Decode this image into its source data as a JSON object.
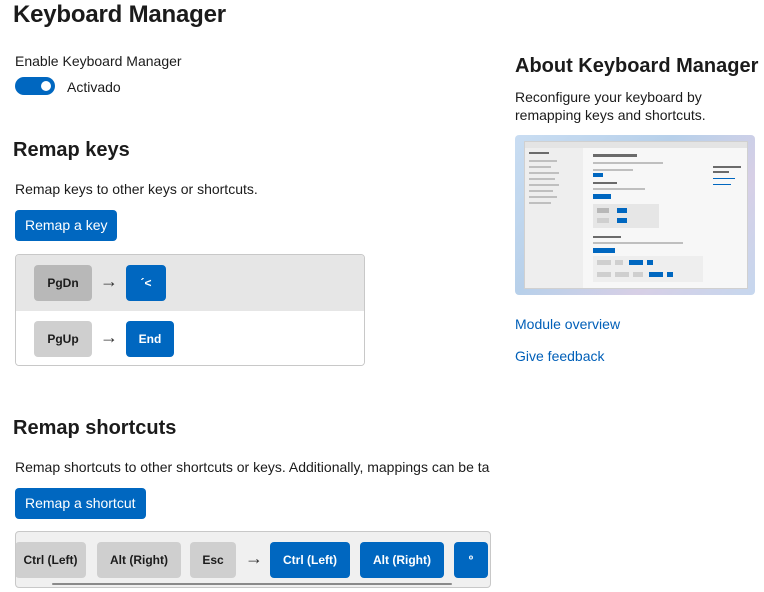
{
  "page_title": "Keyboard Manager",
  "enable": {
    "label": "Enable Keyboard Manager",
    "state_label": "Activado",
    "on": true
  },
  "remap_keys": {
    "heading": "Remap keys",
    "description": "Remap keys to other keys or shortcuts.",
    "button_label": "Remap a key",
    "rows": [
      {
        "from": "PgDn",
        "to": "´<"
      },
      {
        "from": "PgUp",
        "to": "End"
      }
    ]
  },
  "remap_shortcuts": {
    "heading": "Remap shortcuts",
    "description": "Remap shortcuts to other shortcuts or keys. Additionally, mappings can be ta",
    "button_label": "Remap a shortcut",
    "row": {
      "from": [
        "Ctrl (Left)",
        "Alt (Right)",
        "Esc"
      ],
      "to": [
        "Ctrl (Left)",
        "Alt (Right)",
        "º"
      ]
    }
  },
  "about": {
    "heading": "About Keyboard Manager",
    "description_line1": "Reconfigure your keyboard by",
    "description_line2": "remapping keys and shortcuts.",
    "links": {
      "module_overview": "Module overview",
      "give_feedback": "Give feedback"
    }
  },
  "icons": {
    "arrow": "→"
  },
  "colors": {
    "accent": "#0067c0",
    "link": "#005fb8"
  }
}
